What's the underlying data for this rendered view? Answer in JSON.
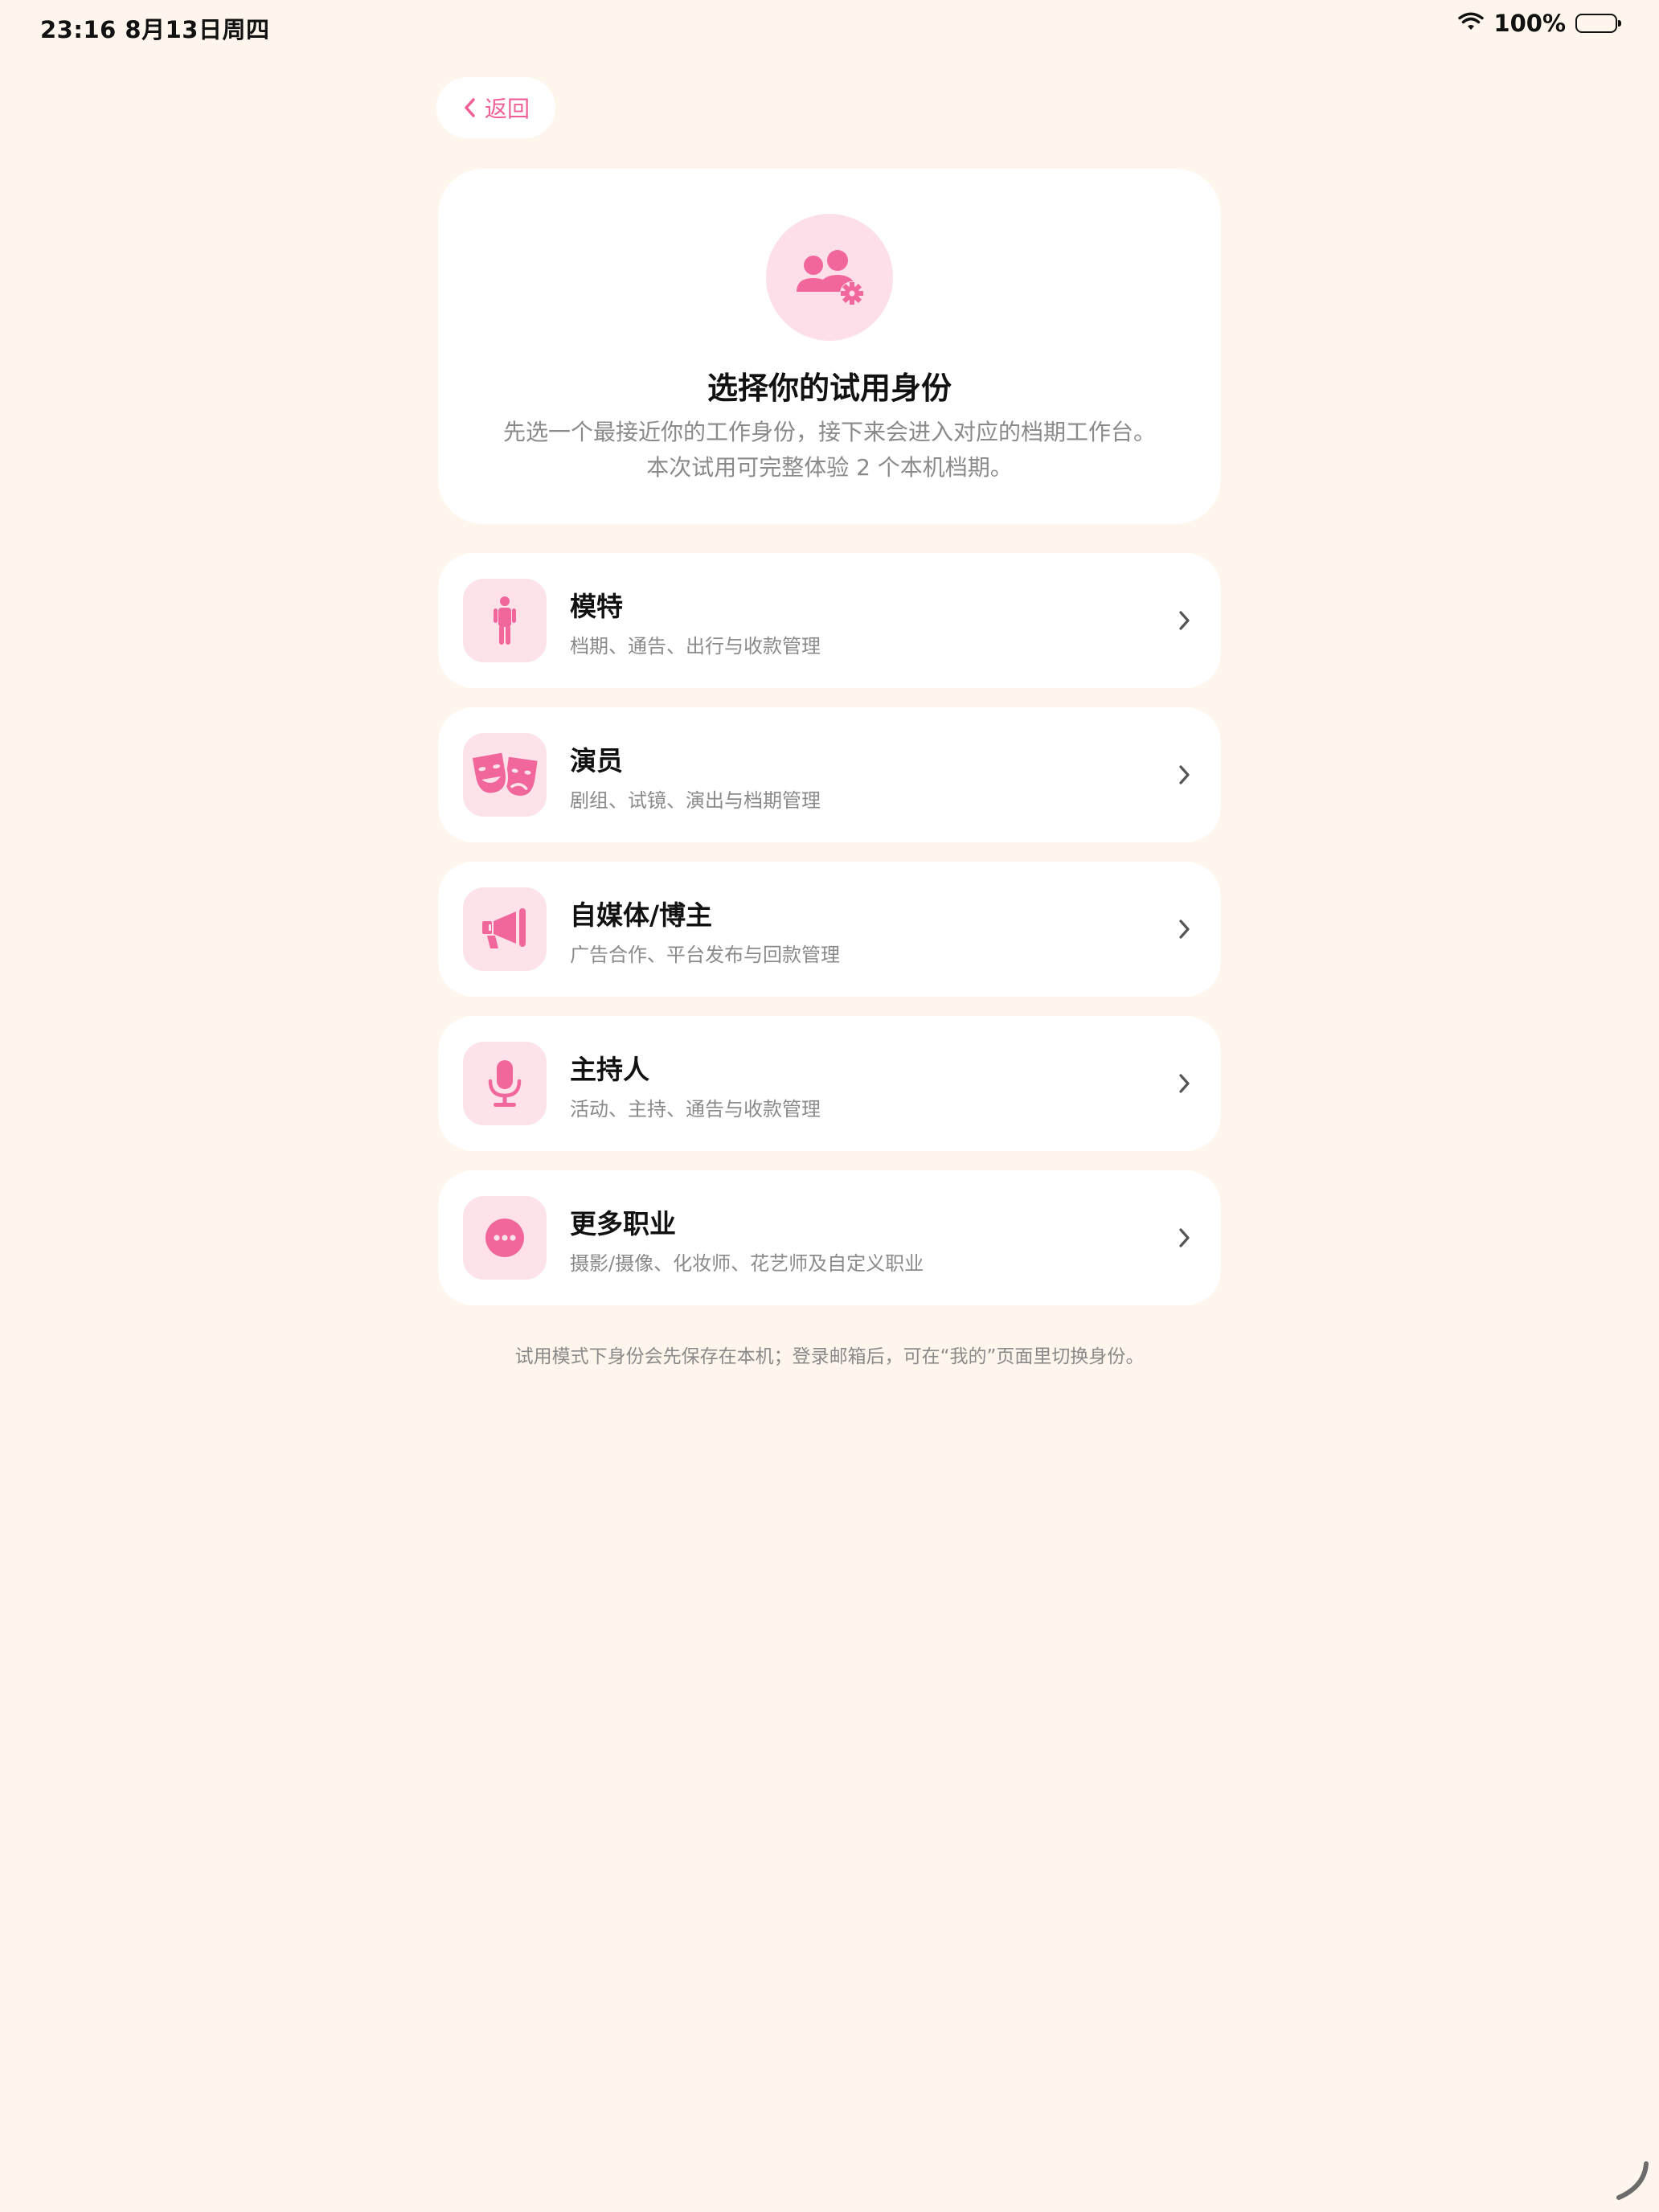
{
  "status_bar": {
    "time": "23:16   8月13日周四",
    "battery": "100%"
  },
  "back_button": {
    "label": "返回"
  },
  "header": {
    "title": "选择你的试用身份",
    "desc_line1": "先选一个最接近你的工作身份，接下来会进入对应的档期工作台。",
    "desc_line2": "本次试用可完整体验 2 个本机档期。",
    "icon": "people-gear-icon"
  },
  "options": [
    {
      "title": "模特",
      "subtitle": "档期、通告、出行与收款管理",
      "icon": "person-icon"
    },
    {
      "title": "演员",
      "subtitle": "剧组、试镜、演出与档期管理",
      "icon": "theater-masks-icon"
    },
    {
      "title": "自媒体/博主",
      "subtitle": "广告合作、平台发布与回款管理",
      "icon": "megaphone-icon"
    },
    {
      "title": "主持人",
      "subtitle": "活动、主持、通告与收款管理",
      "icon": "microphone-icon"
    },
    {
      "title": "更多职业",
      "subtitle": "摄影/摄像、化妆师、花艺师及自定义职业",
      "icon": "more-dots-icon"
    }
  ],
  "footnote": "试用模式下身份会先保存在本机；登录邮箱后，可在“我的”页面里切换身份。",
  "colors": {
    "background": "#fef6ec",
    "accent": "#ef5e96",
    "icon_bg": "#fde2ea",
    "card": "#ffffff",
    "muted_text": "#8a8a8a"
  }
}
